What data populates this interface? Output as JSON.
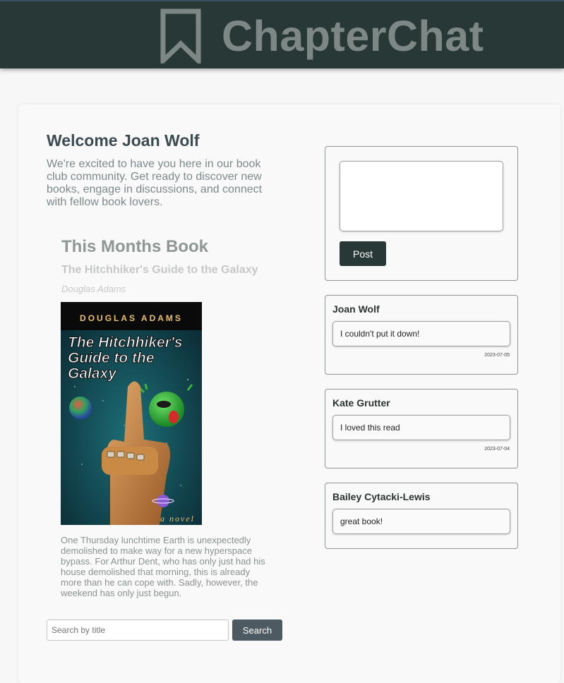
{
  "header": {
    "logo_text": "ChapterChat",
    "logo_icon": "bookmark-icon",
    "background": "#283836"
  },
  "welcome": {
    "title": "Welcome Joan Wolf",
    "text": "We're excited to have you here in our book club community. Get ready to discover new books, engage in discussions, and connect with fellow book lovers."
  },
  "book": {
    "section_title": "This Months Book",
    "title": "The Hitchhiker's Guide to the Galaxy",
    "author": "Douglas Adams",
    "cover": {
      "top_text": "DOUGLAS ADAMS",
      "title_lines": [
        "The Hitchhiker's",
        "Guide to the",
        "Galaxy"
      ],
      "bottom_text": "a novel"
    },
    "description": "One Thursday lunchtime Earth is unexpectedly demolished to make way for a new hyperspace bypass. For Arthur Dent, who has only just had his house demolished that morning, this is already more than he can cope with. Sadly, however, the weekend has only just begun."
  },
  "search": {
    "placeholder": "Search by title",
    "button_label": "Search"
  },
  "post": {
    "textarea_value": "",
    "button_label": "Post"
  },
  "comments": [
    {
      "author": "Joan Wolf",
      "text": "I couldn't put it down!",
      "date": "2023-07-05"
    },
    {
      "author": "Kate Grutter",
      "text": "I loved this read",
      "date": "2023-07-04"
    },
    {
      "author": "Bailey Cytacki-Lewis",
      "text": "great book!",
      "date": ""
    }
  ]
}
